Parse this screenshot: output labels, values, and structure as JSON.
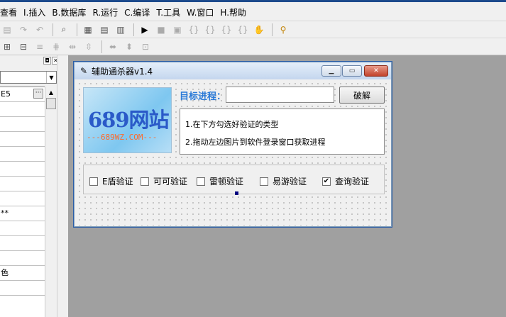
{
  "menu": [
    "查看",
    "I.插入",
    "B.数据库",
    "R.运行",
    "C.编译",
    "T.工具",
    "W.窗口",
    "H.帮助"
  ],
  "toolbar1": [
    "paste-icon",
    "redo-icon",
    "undo-icon",
    "find-icon",
    "layout1-icon",
    "layout2-icon",
    "layout3-icon",
    "run-icon",
    "stop-icon",
    "step-icon",
    "brace1-icon",
    "brace2-icon",
    "brace3-icon",
    "brace4-icon",
    "hand-icon",
    "search-people-icon"
  ],
  "toolbar2": [
    "align1-icon",
    "align2-icon",
    "align3-icon",
    "align4-icon",
    "align5-icon",
    "align6-icon",
    "size1-icon",
    "size2-icon",
    "size3-icon"
  ],
  "left_panel": {
    "rows": [
      "E5",
      "",
      "",
      "",
      "",
      "",
      "",
      "",
      "**",
      "",
      "",
      "",
      "色",
      ""
    ]
  },
  "form": {
    "title": "辅助通杀器v1.4",
    "logo_text": "689网站",
    "logo_sub": "---689WZ.COM---",
    "target_label": "目标进程：",
    "target_value": "",
    "crack_button": "破解",
    "hints": [
      "1.在下方勾选好验证的类型",
      "2.拖动左边图片到软件登录窗口获取进程"
    ],
    "checkboxes": [
      {
        "label": "E盾验证",
        "checked": false
      },
      {
        "label": "可可验证",
        "checked": false
      },
      {
        "label": "雷顿验证",
        "checked": false
      },
      {
        "label": "易游验证",
        "checked": false
      },
      {
        "label": "查询验证",
        "checked": true
      }
    ]
  },
  "colors": {
    "accent": "#2a7ad8",
    "logo_text": "#2a5ac8",
    "logo_sub": "#ff6a2a"
  }
}
